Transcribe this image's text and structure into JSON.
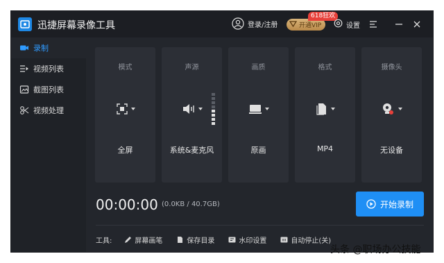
{
  "app": {
    "title": "迅捷屏幕录像工具"
  },
  "titlebar": {
    "login_label": "登录/注册",
    "vip_label": "开通VIP",
    "vip_badge": "618狂欢",
    "settings_label": "设置",
    "icons": [
      "user-icon",
      "vip-icon",
      "gear-icon",
      "menu-icon",
      "minimize-icon",
      "close-icon"
    ]
  },
  "sidebar": {
    "items": [
      {
        "label": "录制",
        "icon": "camera-icon",
        "active": true
      },
      {
        "label": "视频列表",
        "icon": "video-list-icon",
        "active": false
      },
      {
        "label": "截图列表",
        "icon": "screenshot-list-icon",
        "active": false
      },
      {
        "label": "视频处理",
        "icon": "video-tools-icon",
        "active": false
      }
    ]
  },
  "cards": [
    {
      "label": "模式",
      "value": "全屏",
      "icon": "fullscreen-icon"
    },
    {
      "label": "声源",
      "value": "系统&麦克风",
      "icon": "speaker-icon"
    },
    {
      "label": "画质",
      "value": "原画",
      "icon": "monitor-icon"
    },
    {
      "label": "格式",
      "value": "MP4",
      "icon": "file-icon"
    },
    {
      "label": "摄像头",
      "value": "无设备",
      "icon": "webcam-icon"
    }
  ],
  "status": {
    "timer": "00:00:00",
    "size": "(0.0KB / 40.7GB)"
  },
  "record_button": {
    "label": "开始录制"
  },
  "toolbar": {
    "label": "工具:",
    "tools": [
      {
        "label": "屏幕画笔",
        "icon": "pen-icon"
      },
      {
        "label": "保存目录",
        "icon": "folder-icon"
      },
      {
        "label": "水印设置",
        "icon": "watermark-icon"
      },
      {
        "label": "自动停止(关)",
        "icon": "auto-stop-icon"
      }
    ]
  },
  "watermark": {
    "text": "头条 @职场办公技能"
  },
  "colors": {
    "accent": "#1f8ff5",
    "background": "#23262c",
    "card": "#2c2f36",
    "badge": "#e8403a"
  }
}
